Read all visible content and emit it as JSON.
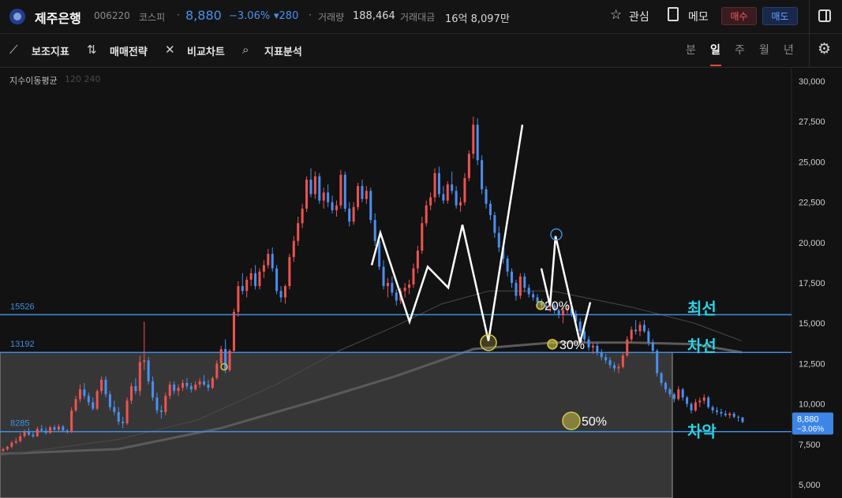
{
  "header": {
    "stock_name": "제주은행",
    "stock_code": "006220",
    "market": "코스피",
    "separator": "·",
    "price": "8,880",
    "change_pct": "−3.06%",
    "change_abs": "▾280",
    "volume_label": "거래량",
    "volume_value": "188,464",
    "amount_label": "거래대금",
    "amount_value": "16억 8,097만",
    "favorite_label": "관심",
    "memo_label": "메모",
    "buy_label": "매수",
    "sell_label": "매도",
    "icons": [
      "bank-logo-icon",
      "star-icon",
      "memo-icon",
      "panel-toggle-icon"
    ]
  },
  "toolbar": {
    "indicators_label": "보조지표",
    "strategy_label": "매매전략",
    "compare_label": "비교차트",
    "analysis_label": "지표분석",
    "periods": [
      "분",
      "일",
      "주",
      "월",
      "년"
    ],
    "active_period": "일",
    "icons": [
      "indicator-icon",
      "strategy-icon",
      "compare-icon",
      "analysis-icon",
      "settings-icon"
    ]
  },
  "chart_data": {
    "type": "candlestick",
    "indicator_label": "지수이동평균",
    "indicator_params": "120 240",
    "y_ticks": [
      "30,000",
      "27,500",
      "25,000",
      "22,500",
      "20,000",
      "17,500",
      "15,000",
      "12,500",
      "10,000",
      "7,500",
      "5,000"
    ],
    "ylim": [
      5000,
      30000
    ],
    "current_price": "8,880",
    "current_change": "−3.06%",
    "colors": {
      "up": "#ef5350",
      "down": "#4a8ff0",
      "hline": "#3d8fe0",
      "annotation": "#29d3e8",
      "marker": "#d4c84a",
      "background": "#121212"
    },
    "horizontal_lines": [
      {
        "value": 15526,
        "label": "15526",
        "note": "최선"
      },
      {
        "value": 13192,
        "label": "13192",
        "note": "차선"
      },
      {
        "value": 8285,
        "label": "8285",
        "note": "차악"
      }
    ],
    "retracement_labels": [
      "20%",
      "30%",
      "50%"
    ],
    "candles": [
      [
        7100,
        7300,
        7000,
        7200
      ],
      [
        7200,
        7400,
        7100,
        7350
      ],
      [
        7350,
        7700,
        7250,
        7600
      ],
      [
        7600,
        7900,
        7500,
        7700
      ],
      [
        7700,
        8200,
        7600,
        8000
      ],
      [
        8000,
        8400,
        7900,
        8250
      ],
      [
        8250,
        8500,
        8000,
        8100
      ],
      [
        8100,
        8300,
        7900,
        8000
      ],
      [
        8000,
        8600,
        7950,
        8450
      ],
      [
        8450,
        8700,
        8300,
        8350
      ],
      [
        8350,
        8550,
        8100,
        8200
      ],
      [
        8200,
        8650,
        8150,
        8550
      ],
      [
        8550,
        8700,
        8350,
        8400
      ],
      [
        8400,
        8750,
        8300,
        8600
      ],
      [
        8600,
        8700,
        8300,
        8350
      ],
      [
        8350,
        8450,
        8150,
        8250
      ],
      [
        8250,
        9800,
        8200,
        9600
      ],
      [
        9600,
        10500,
        9500,
        10300
      ],
      [
        10300,
        11200,
        10100,
        10900
      ],
      [
        10900,
        11300,
        10300,
        10500
      ],
      [
        10500,
        10700,
        9900,
        10100
      ],
      [
        10100,
        10400,
        9600,
        9700
      ],
      [
        9700,
        10900,
        9600,
        10800
      ],
      [
        10800,
        11700,
        10600,
        11500
      ],
      [
        11500,
        11700,
        10400,
        10600
      ],
      [
        10600,
        10800,
        9600,
        9800
      ],
      [
        9800,
        10200,
        9300,
        9500
      ],
      [
        9500,
        9800,
        8700,
        8900
      ],
      [
        8900,
        9200,
        8500,
        8800
      ],
      [
        8800,
        10400,
        8700,
        10200
      ],
      [
        10200,
        11300,
        10000,
        11100
      ],
      [
        11100,
        11600,
        10600,
        10800
      ],
      [
        10800,
        13000,
        10500,
        12600
      ],
      [
        12600,
        15100,
        12100,
        12700
      ],
      [
        12700,
        12900,
        11200,
        11400
      ],
      [
        11400,
        11700,
        10200,
        10400
      ],
      [
        10400,
        10700,
        9400,
        9600
      ],
      [
        9600,
        9900,
        9100,
        9500
      ],
      [
        9500,
        10700,
        9300,
        10500
      ],
      [
        10500,
        11400,
        10300,
        11200
      ],
      [
        11200,
        11400,
        10600,
        10800
      ],
      [
        10800,
        11200,
        10500,
        11000
      ],
      [
        11000,
        11500,
        10800,
        11300
      ],
      [
        11300,
        11600,
        10900,
        11100
      ],
      [
        11100,
        11300,
        10700,
        10900
      ],
      [
        10900,
        11400,
        10800,
        11200
      ],
      [
        11200,
        11600,
        11000,
        11400
      ],
      [
        11400,
        11800,
        11100,
        11200
      ],
      [
        11200,
        11500,
        10800,
        11000
      ],
      [
        11000,
        11700,
        10900,
        11600
      ],
      [
        11600,
        12700,
        11500,
        12500
      ],
      [
        12500,
        13600,
        12300,
        13400
      ],
      [
        13400,
        14000,
        11900,
        12100
      ],
      [
        12100,
        13400,
        12000,
        13300
      ],
      [
        13300,
        15900,
        13200,
        15700
      ],
      [
        15700,
        17600,
        15400,
        17300
      ],
      [
        17300,
        18100,
        16800,
        17000
      ],
      [
        17000,
        17900,
        16600,
        17700
      ],
      [
        17700,
        18400,
        17300,
        18100
      ],
      [
        18100,
        18600,
        17100,
        17300
      ],
      [
        17300,
        18400,
        17100,
        18200
      ],
      [
        18200,
        18900,
        17800,
        18600
      ],
      [
        18600,
        19600,
        18400,
        19300
      ],
      [
        19300,
        19700,
        18200,
        18400
      ],
      [
        18400,
        18600,
        16800,
        17000
      ],
      [
        17000,
        17300,
        16300,
        16600
      ],
      [
        16600,
        17400,
        16200,
        17300
      ],
      [
        17300,
        19300,
        17100,
        19100
      ],
      [
        19100,
        20400,
        18800,
        20100
      ],
      [
        20100,
        21600,
        19800,
        21200
      ],
      [
        21200,
        22400,
        20900,
        22100
      ],
      [
        22100,
        24100,
        21900,
        23900
      ],
      [
        23900,
        24600,
        22800,
        23000
      ],
      [
        23000,
        24400,
        22700,
        24100
      ],
      [
        24100,
        24300,
        22400,
        22600
      ],
      [
        22600,
        23400,
        22100,
        23100
      ],
      [
        23100,
        23600,
        22200,
        22500
      ],
      [
        22500,
        22900,
        21800,
        22000
      ],
      [
        22000,
        22600,
        21600,
        22300
      ],
      [
        22300,
        24500,
        22100,
        24200
      ],
      [
        24200,
        24400,
        21900,
        22100
      ],
      [
        22100,
        22500,
        21000,
        21300
      ],
      [
        21300,
        22500,
        21100,
        22200
      ],
      [
        22200,
        23700,
        22000,
        23500
      ],
      [
        23500,
        23900,
        22500,
        22700
      ],
      [
        22700,
        23500,
        22400,
        23200
      ],
      [
        23200,
        23400,
        21200,
        21400
      ],
      [
        21400,
        21800,
        19800,
        20100
      ],
      [
        20100,
        20400,
        18300,
        18500
      ],
      [
        18500,
        18900,
        17100,
        17300
      ],
      [
        17300,
        17800,
        16600,
        17500
      ],
      [
        17500,
        17900,
        16700,
        16900
      ],
      [
        16900,
        17100,
        16100,
        16400
      ],
      [
        16400,
        17200,
        16200,
        17000
      ],
      [
        17000,
        17500,
        16600,
        17200
      ],
      [
        17200,
        17700,
        16800,
        17400
      ],
      [
        17400,
        18700,
        17200,
        18400
      ],
      [
        18400,
        19800,
        18100,
        19500
      ],
      [
        19500,
        21600,
        19300,
        21200
      ],
      [
        21200,
        22600,
        21000,
        22300
      ],
      [
        22300,
        23100,
        22000,
        22800
      ],
      [
        22800,
        24600,
        22500,
        24300
      ],
      [
        24300,
        24700,
        22800,
        23000
      ],
      [
        23000,
        23500,
        22400,
        22600
      ],
      [
        22600,
        23800,
        22400,
        23600
      ],
      [
        23600,
        24400,
        23000,
        23200
      ],
      [
        23200,
        23500,
        22100,
        22300
      ],
      [
        22300,
        22800,
        21900,
        22500
      ],
      [
        22500,
        24300,
        22300,
        24000
      ],
      [
        24000,
        25700,
        23800,
        25500
      ],
      [
        25500,
        27800,
        25200,
        27300
      ],
      [
        27300,
        27700,
        24800,
        25100
      ],
      [
        25100,
        25400,
        23000,
        23300
      ],
      [
        23300,
        23500,
        22100,
        22400
      ],
      [
        22400,
        22600,
        21400,
        21700
      ],
      [
        21700,
        21900,
        20300,
        20600
      ],
      [
        20600,
        21000,
        19400,
        19700
      ],
      [
        19700,
        19900,
        18700,
        19000
      ],
      [
        19000,
        19200,
        17900,
        18200
      ],
      [
        18200,
        18400,
        17200,
        17500
      ],
      [
        17500,
        17700,
        16400,
        16700
      ],
      [
        16700,
        18100,
        16500,
        17900
      ],
      [
        17900,
        18100,
        16900,
        17200
      ],
      [
        17200,
        17400,
        16600,
        16800
      ],
      [
        16800,
        17000,
        16400,
        16600
      ],
      [
        16600,
        16800,
        16100,
        16300
      ],
      [
        16300,
        16500,
        15900,
        16100
      ],
      [
        16100,
        16300,
        15800,
        16000
      ],
      [
        16000,
        16300,
        15700,
        16100
      ],
      [
        16100,
        16200,
        15600,
        15800
      ],
      [
        15800,
        15900,
        15300,
        15500
      ],
      [
        15500,
        16000,
        15000,
        15800
      ],
      [
        15800,
        16200,
        15600,
        15900
      ],
      [
        15900,
        16100,
        15400,
        15600
      ],
      [
        15600,
        15800,
        14900,
        15100
      ],
      [
        15100,
        15300,
        14300,
        14500
      ],
      [
        14500,
        14700,
        13800,
        14000
      ],
      [
        14000,
        14200,
        13300,
        13500
      ],
      [
        13500,
        13800,
        13100,
        13600
      ],
      [
        13600,
        13800,
        13000,
        13200
      ],
      [
        13200,
        13400,
        12700,
        12900
      ],
      [
        12900,
        13100,
        12500,
        12700
      ],
      [
        12700,
        12900,
        12200,
        12400
      ],
      [
        12400,
        12600,
        12000,
        12200
      ],
      [
        12200,
        12500,
        11900,
        12300
      ],
      [
        12300,
        13200,
        12200,
        13000
      ],
      [
        13000,
        14200,
        12900,
        14000
      ],
      [
        14000,
        14800,
        13800,
        14600
      ],
      [
        14600,
        15200,
        14300,
        14500
      ],
      [
        14500,
        15100,
        14200,
        14900
      ],
      [
        14900,
        15200,
        14400,
        14500
      ],
      [
        14500,
        14700,
        13600,
        13800
      ],
      [
        13800,
        14000,
        13100,
        13300
      ],
      [
        13300,
        13400,
        11700,
        11900
      ],
      [
        11900,
        12000,
        11100,
        11300
      ],
      [
        11300,
        11400,
        10700,
        10900
      ],
      [
        10900,
        11000,
        10400,
        10600
      ],
      [
        10600,
        10700,
        10100,
        10300
      ],
      [
        10300,
        11100,
        10200,
        10900
      ],
      [
        10900,
        11000,
        10200,
        10400
      ],
      [
        10400,
        10500,
        9800,
        10000
      ],
      [
        10000,
        10100,
        9400,
        9600
      ],
      [
        9600,
        10300,
        9500,
        10100
      ],
      [
        10100,
        10400,
        9800,
        10200
      ],
      [
        10200,
        10600,
        10000,
        10400
      ],
      [
        10400,
        10500,
        9700,
        9800
      ],
      [
        9800,
        9900,
        9400,
        9600
      ],
      [
        9600,
        9800,
        9300,
        9500
      ],
      [
        9500,
        9700,
        9200,
        9400
      ],
      [
        9400,
        9600,
        9200,
        9300
      ],
      [
        9300,
        9500,
        9100,
        9400
      ],
      [
        9400,
        9500,
        9100,
        9200
      ],
      [
        9200,
        9300,
        8900,
        9160
      ],
      [
        9160,
        9200,
        8800,
        8880
      ]
    ]
  }
}
